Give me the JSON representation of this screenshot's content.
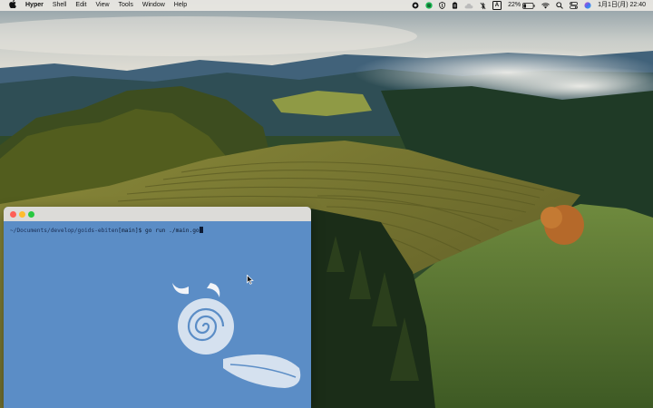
{
  "menubar": {
    "app_name": "Hyper",
    "menus": [
      "Shell",
      "Edit",
      "View",
      "Tools",
      "Window",
      "Help"
    ],
    "status": {
      "battery_percent": "22%",
      "input_source": "A",
      "date_time": "1月1日(月) 22:40"
    }
  },
  "terminal": {
    "cwd": "~/Documents/develop/goids-ebiten",
    "branch": "[main]",
    "prompt_symbol": "$",
    "command": "go run ./main.go",
    "background": "#5b8dc6"
  },
  "icons": [
    "apple-icon",
    "record-icon",
    "spotify-icon",
    "shield-icon",
    "clipboard-icon",
    "cloud-icon",
    "bluetooth-off-icon",
    "input-source-icon",
    "battery-icon",
    "wifi-icon",
    "search-icon",
    "control-center-icon",
    "siri-icon",
    "snail-mascot",
    "mouse-pointer-icon"
  ]
}
